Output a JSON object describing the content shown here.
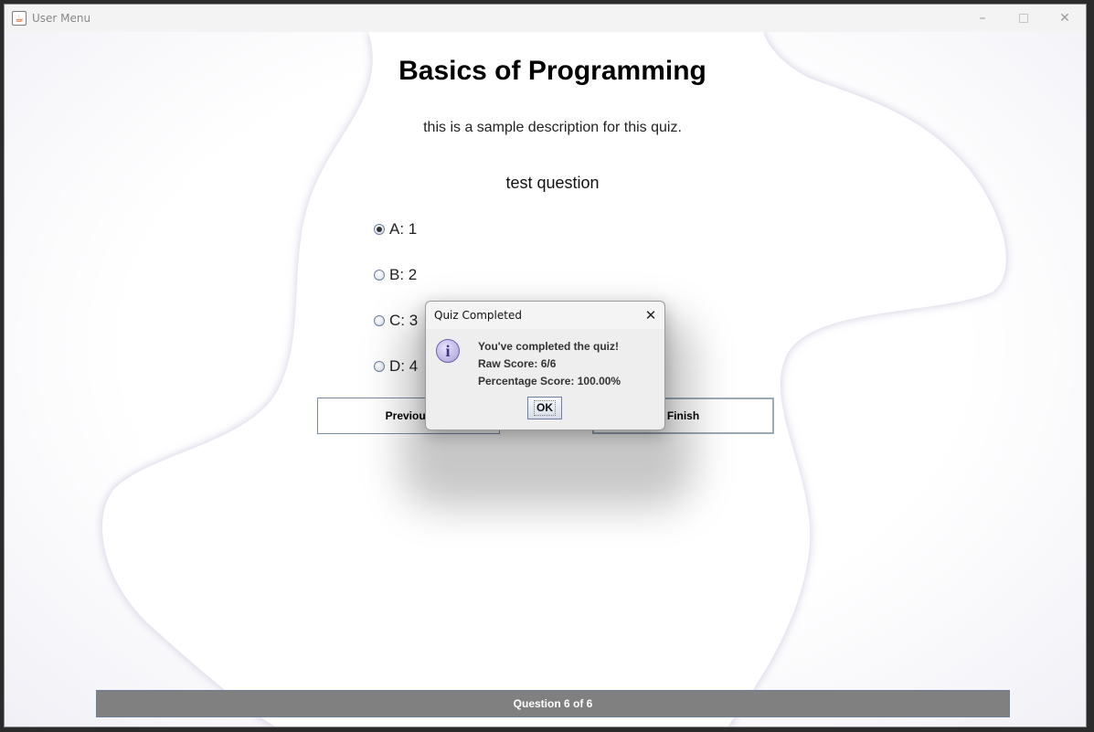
{
  "window": {
    "title": "User Menu",
    "app_icon": "java-cup-icon",
    "controls": {
      "minimize": "–",
      "close": "✕"
    }
  },
  "quiz": {
    "title": "Basics of Programming",
    "description": "this is a sample description for this quiz.",
    "question": "test question",
    "options": [
      {
        "label": "A: 1",
        "selected": true
      },
      {
        "label": "B: 2",
        "selected": false
      },
      {
        "label": "C: 3",
        "selected": false
      },
      {
        "label": "D: 4",
        "selected": false
      }
    ],
    "buttons": {
      "previous": "Previous",
      "finish": "Finish"
    },
    "progress": "Question 6 of 6"
  },
  "dialog": {
    "title": "Quiz Completed",
    "icon": "info-icon",
    "icon_glyph": "i",
    "close_glyph": "✕",
    "lines": [
      "You've completed the quiz!",
      "Raw Score: 6/6",
      "Percentage Score: 100.00%"
    ],
    "ok_label": "OK"
  },
  "colors": {
    "status_bar": "#808080",
    "button_border": "#7a8ba8"
  }
}
